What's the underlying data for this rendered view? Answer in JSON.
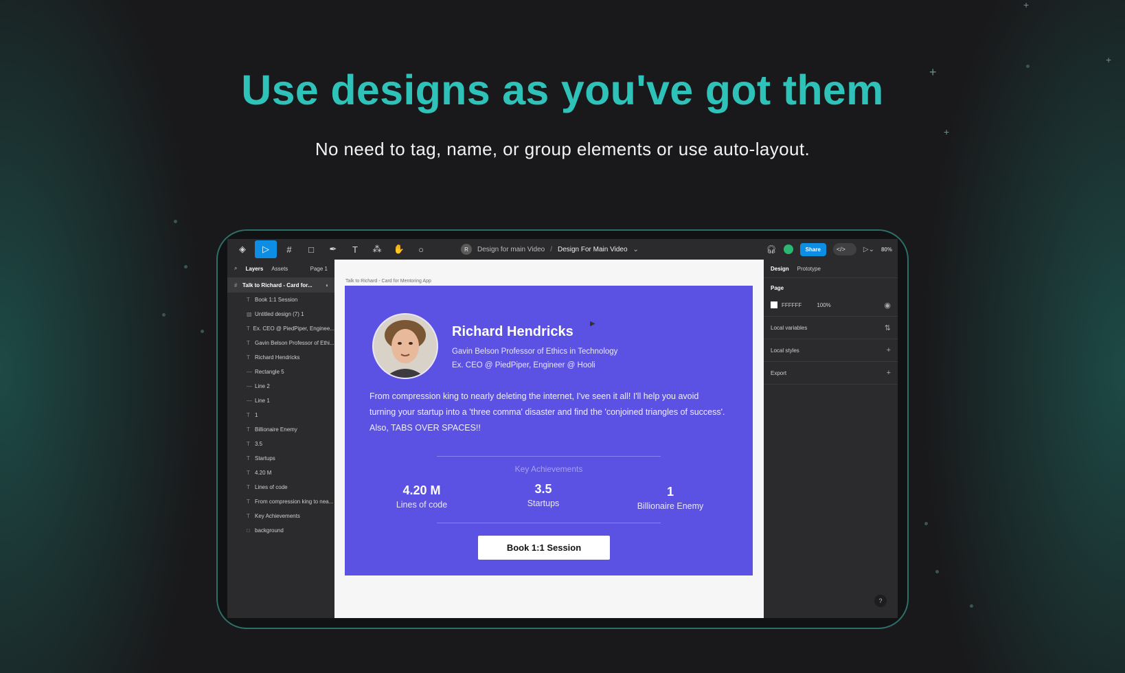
{
  "hero": {
    "title": "Use designs as you've got them",
    "subtitle": "No need to tag, name, or group elements or use auto-layout."
  },
  "toolbar": {
    "tools": [
      "figma-menu-icon",
      "move-icon",
      "frame-icon",
      "rectangle-icon",
      "pen-icon",
      "text-icon",
      "components-icon",
      "hand-icon",
      "comment-icon"
    ],
    "file_owner_initial": "R",
    "project": "Design for main Video",
    "separator": "/",
    "file_name": "Design For Main Video",
    "share_label": "Share",
    "code_label": "</>",
    "zoom": "80%"
  },
  "left_panel": {
    "tabs": [
      "Layers",
      "Assets"
    ],
    "page": "Page 1",
    "frame": "Talk to Richard - Card for...",
    "layers": [
      {
        "type": "text",
        "name": "Book 1:1 Session"
      },
      {
        "type": "image",
        "name": "Untitled design (7) 1"
      },
      {
        "type": "text",
        "name": "Ex. CEO @ PiedPiper, Enginee..."
      },
      {
        "type": "text",
        "name": "Gavin Belson Professor of Ethi..."
      },
      {
        "type": "text",
        "name": "Richard Hendricks"
      },
      {
        "type": "line",
        "name": "Rectangle 5"
      },
      {
        "type": "line",
        "name": "Line 2"
      },
      {
        "type": "line",
        "name": "Line 1"
      },
      {
        "type": "text",
        "name": "1"
      },
      {
        "type": "text",
        "name": "Billionaire Enemy"
      },
      {
        "type": "text",
        "name": "3.5"
      },
      {
        "type": "text",
        "name": "Startups"
      },
      {
        "type": "text",
        "name": "4.20 M"
      },
      {
        "type": "text",
        "name": "Lines of code"
      },
      {
        "type": "text",
        "name": "From compression king to nea..."
      },
      {
        "type": "text",
        "name": "Key Achievements"
      },
      {
        "type": "rect",
        "name": "background"
      }
    ]
  },
  "canvas": {
    "frame_label": "Talk to Richard - Card for Mentoring App",
    "card": {
      "name": "Richard Hendricks",
      "role": "Gavin Belson Professor of Ethics in Technology",
      "role2": "Ex. CEO @ PiedPiper, Engineer @ Hooli",
      "bio": "From compression king to nearly deleting the internet, I've seen it all! I'll help you avoid turning your startup into a 'three comma' disaster and find the 'conjoined triangles of success'. Also, TABS OVER SPACES!!",
      "achievements_title": "Key Achievements",
      "stats": [
        {
          "value": "4.20 M",
          "label": "Lines of code"
        },
        {
          "value": "3.5",
          "label": "Startups"
        },
        {
          "value": "1",
          "label": "Billionaire Enemy"
        }
      ],
      "cta": "Book 1:1 Session",
      "accent_color": "#5b51e2"
    }
  },
  "right_panel": {
    "tabs": [
      "Design",
      "Prototype"
    ],
    "page_label": "Page",
    "page_fill": "FFFFFF",
    "page_opacity": "100%",
    "local_variables": "Local variables",
    "local_styles": "Local styles",
    "export": "Export",
    "help": "?"
  }
}
